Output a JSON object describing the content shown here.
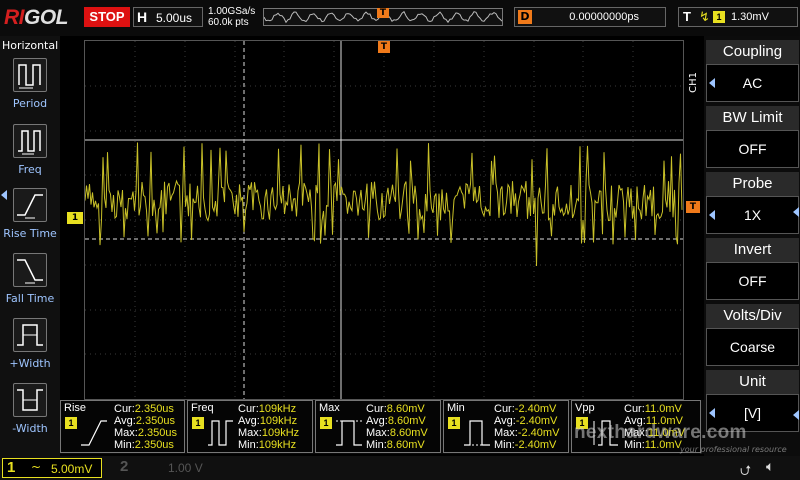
{
  "top": {
    "logo_prefix": "RI",
    "logo_suffix": "GOL",
    "run_state": "STOP",
    "h_label": "H",
    "timebase": "5.00us",
    "sample_rate": "1.00GSa/s",
    "mem_depth": "60.0k pts",
    "trigger_marker": "T",
    "delay_label": "D",
    "delay_value": "0.00000000ps",
    "trig_label": "T",
    "trig_channel": "1",
    "trig_level": "1.30mV"
  },
  "left_panel": {
    "title": "Horizontal",
    "items": [
      {
        "label": "Period",
        "icon": "period-icon"
      },
      {
        "label": "Freq",
        "icon": "freq-icon"
      },
      {
        "label": "Rise Time",
        "icon": "rise-time-icon"
      },
      {
        "label": "Fall Time",
        "icon": "fall-time-icon"
      },
      {
        "label": "+Width",
        "icon": "pos-width-icon"
      },
      {
        "label": "-Width",
        "icon": "neg-width-icon"
      }
    ]
  },
  "grid": {
    "ch1_marker": "1",
    "trig_level_marker": "T",
    "trig_pos_marker": "T",
    "trace_color": "#c8c028"
  },
  "right_panel": {
    "channel_label": "CH1",
    "items": [
      {
        "title": "Coupling",
        "value": "AC"
      },
      {
        "title": "BW Limit",
        "value": "OFF"
      },
      {
        "title": "Probe",
        "value": "1X"
      },
      {
        "title": "Invert",
        "value": "OFF"
      },
      {
        "title": "Volts/Div",
        "value": "Coarse"
      },
      {
        "title": "Unit",
        "value": "[V]"
      }
    ]
  },
  "measurements": [
    {
      "name": "Rise",
      "ch": "1",
      "cur": "2.350us",
      "avg": "2.350us",
      "max": "2.350us",
      "min": "2.350us"
    },
    {
      "name": "Freq",
      "ch": "1",
      "cur": "109kHz",
      "avg": "109kHz",
      "max": "109kHz",
      "min": "109kHz"
    },
    {
      "name": "Max",
      "ch": "1",
      "cur": "8.60mV",
      "avg": "8.60mV",
      "max": "8.60mV",
      "min": "8.60mV"
    },
    {
      "name": "Min",
      "ch": "1",
      "cur": "-2.40mV",
      "avg": "-2.40mV",
      "max": "-2.40mV",
      "min": "-2.40mV"
    },
    {
      "name": "Vpp",
      "ch": "1",
      "cur": "11.0mV",
      "avg": "11.0mV",
      "max": "11.0mV",
      "min": "11.0mV"
    }
  ],
  "meas_labels": {
    "cur": "Cur:",
    "avg": "Avg:",
    "max": "Max:",
    "min": "Min:"
  },
  "bottom": {
    "ch1_num": "1",
    "ch1_coupling_symbol": "~",
    "ch1_scale": "5.00mV",
    "ch2_num": "2",
    "ch2_scale": "1.00 V",
    "watermark": "nexthardware.com",
    "watermark_sub": "your professional resource"
  }
}
